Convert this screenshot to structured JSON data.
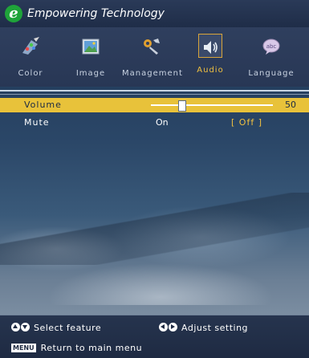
{
  "header": {
    "logo_letter": "e",
    "brand": "Empowering Technology"
  },
  "tabs": [
    {
      "label": "Color",
      "icon": "color-palette-icon",
      "active": false
    },
    {
      "label": "Image",
      "icon": "image-icon",
      "active": false
    },
    {
      "label": "Management",
      "icon": "management-tools-icon",
      "active": false
    },
    {
      "label": "Audio",
      "icon": "speaker-icon",
      "active": true
    },
    {
      "label": "Language",
      "icon": "language-bubble-icon",
      "active": false
    }
  ],
  "settings": {
    "volume": {
      "label": "Volume",
      "value": "50",
      "level_percent": 50
    },
    "mute": {
      "label": "Mute",
      "option_on": "On",
      "option_off": "[ Off ]",
      "selected": "Off"
    }
  },
  "footer": {
    "select_hint": "Select feature",
    "adjust_hint": "Adjust setting",
    "menu_key": "MENU",
    "menu_hint": "Return to main menu"
  },
  "colors": {
    "accent_selected": "#e8c23a",
    "active_tab_label": "#f0c040",
    "logo": "#1fa33a"
  }
}
